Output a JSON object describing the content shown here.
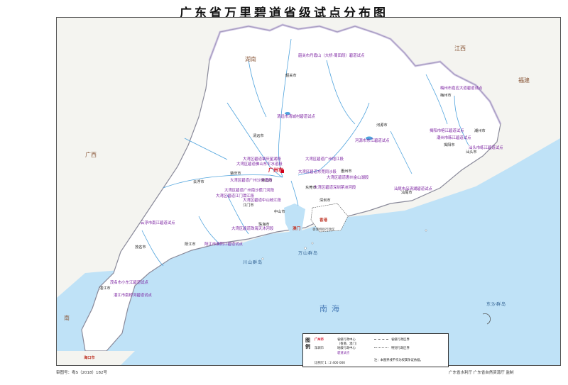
{
  "title": "广东省万里碧道省级试点分布图",
  "map_number": "审图号：粤S（2018）182号",
  "credits": "广东省水利厅 广东省自然资源厅 监制",
  "neighbors": {
    "hunan": "湖南",
    "jiangxi": "江西",
    "fujian": "福建",
    "guangxi": "广西",
    "hainan_text": "南",
    "hk_sar_line": "香港特别行政区"
  },
  "seas": {
    "south_china_sea": "南海",
    "dongsha": "东沙群岛",
    "wanshan": "万山群岛",
    "chuanshan": "川山群岛"
  },
  "cities": {
    "shaoguan": "韶关市",
    "qingyuan": "清远市",
    "heyuan": "河源市",
    "meizhou": "梅州市",
    "chaozhou": "潮州市",
    "shantou": "汕头市",
    "jieyang": "揭阳市",
    "shanwei": "汕尾市",
    "huizhou": "惠州市",
    "dongguan": "东莞市",
    "shenzhen": "深圳市",
    "zhongshan": "中山市",
    "zhuhai": "珠海市",
    "jiangmen": "江门市",
    "foshan": "佛山市",
    "zhaoqing": "肇庆市",
    "yunfu": "云浮市",
    "maoming": "茂名市",
    "yangjiang": "阳江市",
    "zhanjiang": "湛江市",
    "guangzhou": "广州市",
    "hongkong": "香港",
    "macau": "澳门",
    "haikou": "海口市"
  },
  "pilots": [
    "韶关市丹霞山（大桥·周田段）碧道试点",
    "梅州市嘉应大道碧道试点",
    "清远市清城村碧道试点",
    "河源市东江碧道试点",
    "潮州市韩江碧道试点",
    "汕头市练江碧道试点",
    "揭阳市榕江碧道试点",
    "大湾区碧道广州增江段",
    "大湾区碧道佛山东平水道段",
    "大湾区碧道东莞同沙段",
    "大湾区碧道惠州金山湖段",
    "大湾区碧道深圳茅洲河段",
    "大湾区碧道广州沙河涌段",
    "大湾区碧道广州南沙蕉门河段",
    "大湾区碧道中山岐江段",
    "大湾区碧道珠海天沐河段",
    "大湾区碧道江门潭江段",
    "云浮市南江碧道试点",
    "茂名市小东江碧道试点",
    "阳江市漠阳江碧道试点",
    "湛江市南桥河碧道试点",
    "汕尾市品清湖碧道试点",
    "大湾区碧道肇庆星湖段"
  ],
  "legend": {
    "title": "图例",
    "capital": "广州市",
    "capital_desc": "省级行政中心",
    "sar_desc": "（香港、澳门）",
    "city_sample": "深圳市",
    "city_desc": "地级行政中心",
    "pilot_desc": "碧道试点",
    "boundary_provincial": "省级行政区界",
    "boundary_sar": "特别行政区界",
    "scale": "比例尺 1 : 2 400 000",
    "note": "注：本图界线不作为权属争议依据。"
  },
  "colors": {
    "water": "#bfe2f7",
    "river": "#4fa3dd",
    "land": "#ffffff",
    "outside": "#f3f3ef",
    "pilot": "#7a1fa0",
    "capital": "#d0021b"
  }
}
